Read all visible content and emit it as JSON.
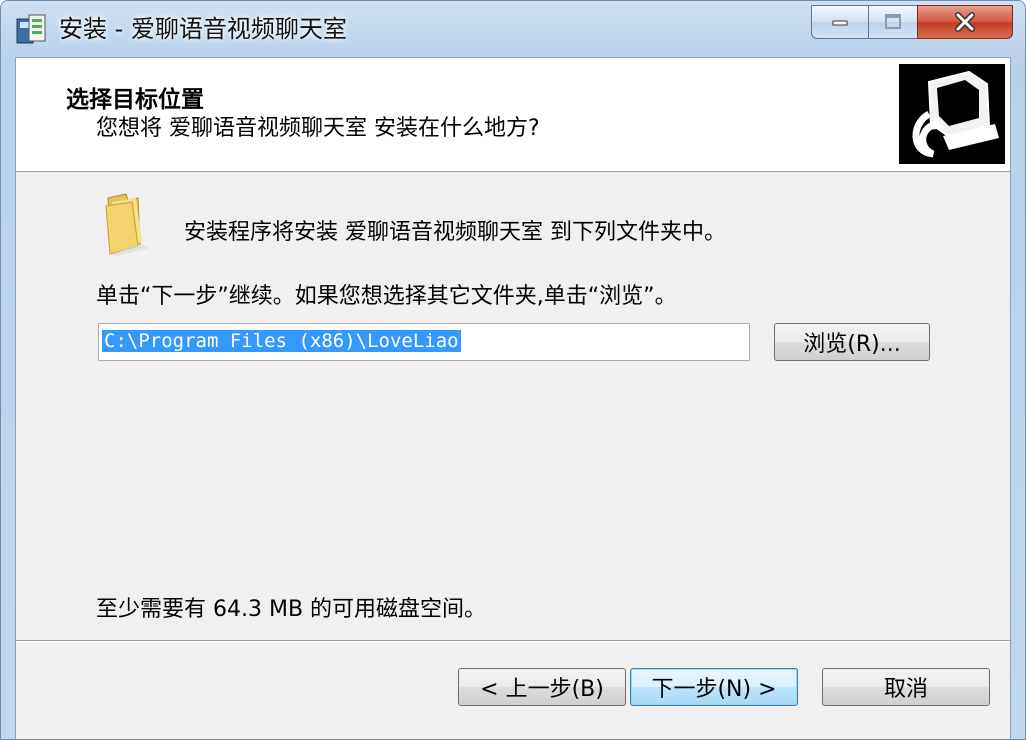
{
  "window": {
    "title": "安装 - 爱聊语音视频聊天室"
  },
  "header": {
    "title": "选择目标位置",
    "subtitle": "您想将 爱聊语音视频聊天室 安装在什么地方?"
  },
  "body": {
    "destination_text": "安装程序将安装 爱聊语音视频聊天室 到下列文件夹中。",
    "instruction_text": "单击“下一步”继续。如果您想选择其它文件夹,单击“浏览”。",
    "install_path": "C:\\Program Files (x86)\\LoveLiao",
    "browse_label": "浏览(R)...",
    "disk_space_text": "至少需要有 64.3 MB 的可用磁盘空间。"
  },
  "footer": {
    "back_label": "< 上一步(B)",
    "next_label": "下一步(N) >",
    "cancel_label": "取消"
  },
  "icons": {
    "app": "installer-app-icon",
    "header": "computer-install-icon",
    "folder": "folder-icon",
    "minimize": "minimize-icon",
    "maximize": "maximize-icon",
    "close": "close-icon"
  },
  "colors": {
    "selection": "#3399ff",
    "close_button": "#c7432a",
    "titlebar": "#b9d1ea"
  }
}
